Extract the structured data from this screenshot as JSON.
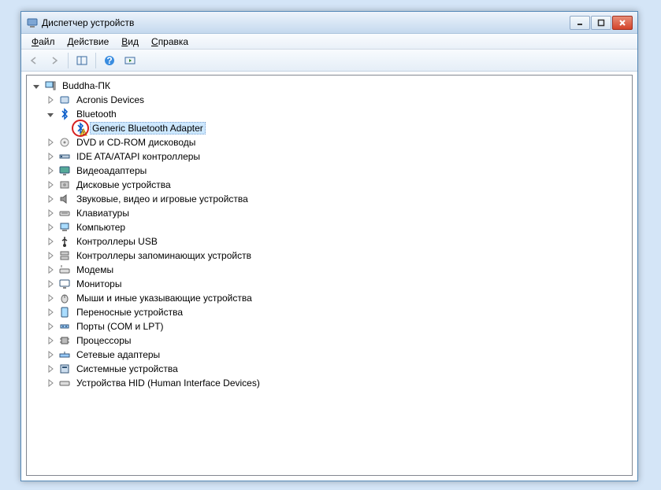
{
  "window": {
    "title": "Диспетчер устройств"
  },
  "menu": {
    "file": "Файл",
    "action": "Действие",
    "view": "Вид",
    "help": "Справка"
  },
  "tree": {
    "root": "Buddha-ПК",
    "categories": [
      {
        "label": "Acronis Devices",
        "icon": "generic"
      },
      {
        "label": "Bluetooth",
        "icon": "bluetooth",
        "expanded": true,
        "children": [
          {
            "label": "Generic Bluetooth Adapter",
            "icon": "bluetooth",
            "selected": true,
            "warning": true,
            "highlight": true
          }
        ]
      },
      {
        "label": "DVD и CD-ROM дисководы",
        "icon": "cdrom"
      },
      {
        "label": "IDE ATA/ATAPI контроллеры",
        "icon": "ide"
      },
      {
        "label": "Видеоадаптеры",
        "icon": "display"
      },
      {
        "label": "Дисковые устройства",
        "icon": "disk"
      },
      {
        "label": "Звуковые, видео и игровые устройства",
        "icon": "sound"
      },
      {
        "label": "Клавиатуры",
        "icon": "keyboard"
      },
      {
        "label": "Компьютер",
        "icon": "computer"
      },
      {
        "label": "Контроллеры USB",
        "icon": "usb"
      },
      {
        "label": "Контроллеры запоминающих устройств",
        "icon": "storagectl"
      },
      {
        "label": "Модемы",
        "icon": "modem"
      },
      {
        "label": "Мониторы",
        "icon": "monitor"
      },
      {
        "label": "Мыши и иные указывающие устройства",
        "icon": "mouse"
      },
      {
        "label": "Переносные устройства",
        "icon": "portable"
      },
      {
        "label": "Порты (COM и LPT)",
        "icon": "ports"
      },
      {
        "label": "Процессоры",
        "icon": "cpu"
      },
      {
        "label": "Сетевые адаптеры",
        "icon": "network"
      },
      {
        "label": "Системные устройства",
        "icon": "system"
      },
      {
        "label": "Устройства HID (Human Interface Devices)",
        "icon": "hid"
      }
    ]
  }
}
